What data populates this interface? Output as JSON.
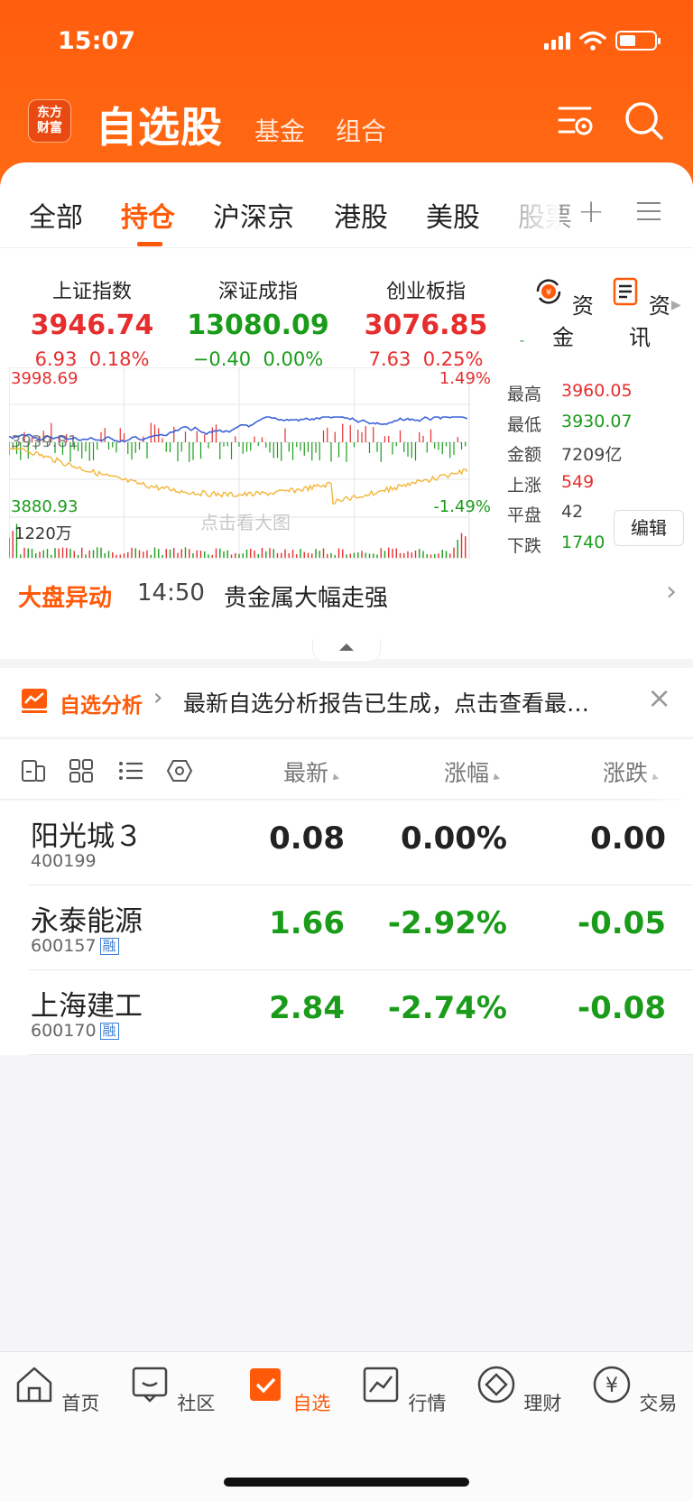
{
  "status": {
    "time": "15:07"
  },
  "header": {
    "logo_line1": "东方",
    "logo_line2": "财富",
    "title": "自选股",
    "subtabs": [
      "基金",
      "组合"
    ],
    "icons": [
      "settings-icon",
      "search-icon"
    ]
  },
  "tabs": {
    "items": [
      "全部",
      "持仓",
      "沪深京",
      "港股",
      "美股",
      "股票"
    ],
    "active": "持仓"
  },
  "indices": [
    {
      "name": "上证指数",
      "value": "3946.74",
      "change": "6.93",
      "pct": "0.18%",
      "trend": "up"
    },
    {
      "name": "深证成指",
      "value": "13080.09",
      "change": "−0.40",
      "pct": "0.00%",
      "trend": "down"
    },
    {
      "name": "创业板指",
      "value": "3076.85",
      "change": "7.63",
      "pct": "0.25%",
      "trend": "up"
    }
  ],
  "side_buttons": {
    "funds": "资金",
    "news": "资讯"
  },
  "chart": {
    "top_left": "3998.69",
    "top_right": "1.49%",
    "mid_left": "3939.81",
    "bottom_left": "3880.93",
    "bottom_right": "-1.49%",
    "volume_label": "1220万",
    "watermark": "点击看大图"
  },
  "stats": [
    {
      "label": "最高",
      "value": "3960.05",
      "color": "#e62e2e"
    },
    {
      "label": "最低",
      "value": "3930.07",
      "color": "#1a9c1a"
    },
    {
      "label": "金额",
      "value": "7209亿",
      "color": "#444444"
    },
    {
      "label": "上涨",
      "value": "549",
      "color": "#e62e2e"
    },
    {
      "label": "平盘",
      "value": "42",
      "color": "#444444"
    },
    {
      "label": "下跌",
      "value": "1740",
      "color": "#1a9c1a"
    }
  ],
  "edit_label": "编辑",
  "market_move": {
    "label": "大盘异动",
    "time": "14:50",
    "text": "贵金属大幅走强"
  },
  "analysis": {
    "label": "自选分析",
    "text": "最新自选分析报告已生成，点击查看最…"
  },
  "list_header": {
    "latest": "最新",
    "change_pct": "涨幅",
    "change": "涨跌"
  },
  "stocks": [
    {
      "name": "阳光城３",
      "code": "400199",
      "rong": false,
      "price": "0.08",
      "pct": "0.00%",
      "chg": "0.00",
      "trend": "flat"
    },
    {
      "name": "永泰能源",
      "code": "600157",
      "rong": true,
      "price": "1.66",
      "pct": "-2.92%",
      "chg": "-0.05",
      "trend": "down"
    },
    {
      "name": "上海建工",
      "code": "600170",
      "rong": true,
      "price": "2.84",
      "pct": "-2.74%",
      "chg": "-0.08",
      "trend": "down"
    }
  ],
  "rong_label": "融",
  "nav": [
    {
      "label": "首页",
      "icon": "home-icon"
    },
    {
      "label": "社区",
      "icon": "chat-icon"
    },
    {
      "label": "自选",
      "icon": "watchlist-icon",
      "active": true
    },
    {
      "label": "行情",
      "icon": "market-chart-icon"
    },
    {
      "label": "理财",
      "icon": "diamond-icon"
    },
    {
      "label": "交易",
      "icon": "yen-icon"
    }
  ],
  "colors": {
    "brand": "#ff5a0a",
    "up": "#e62e2e",
    "down": "#1a9c1a"
  }
}
